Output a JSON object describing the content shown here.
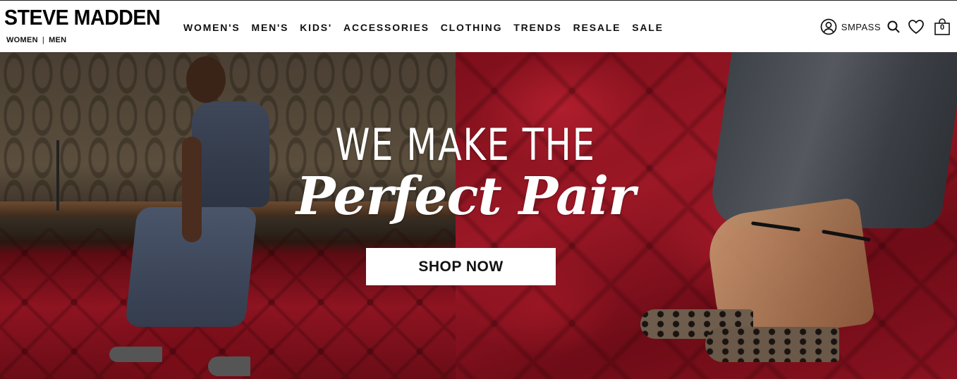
{
  "header": {
    "logo": "STEVE MADDEN",
    "gender_links": [
      "WOMEN",
      "MEN"
    ],
    "gender_separator": "|",
    "nav": [
      "WOMEN'S",
      "MEN'S",
      "KIDS'",
      "ACCESSORIES",
      "CLOTHING",
      "TRENDS",
      "RESALE",
      "SALE"
    ],
    "utils": {
      "account_icon": "user-icon",
      "smpass_label": "SMPASS",
      "search_icon": "search-icon",
      "wishlist_icon": "heart-icon",
      "cart_icon": "shopping-bag-icon",
      "cart_count": "0"
    }
  },
  "hero": {
    "headline_line1": "WE MAKE THE",
    "headline_line2": "Perfect Pair",
    "cta_label": "SHOP NOW"
  },
  "colors": {
    "leather_red": "#9c1826",
    "text_dark": "#111111",
    "cta_bg": "#ffffff"
  }
}
